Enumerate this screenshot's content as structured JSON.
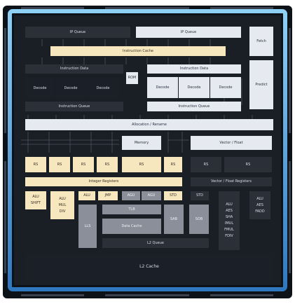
{
  "colors": {
    "outer_glow": "#6fb6ec",
    "die_bg": "#1a1e25",
    "cream_block": "#f6e7bf",
    "light_block": "#e6e9f0",
    "dark_block": "#2a2f38"
  },
  "front_end": {
    "ip_queue_left": "IP Queue",
    "ip_queue_right": "IP Queue",
    "fetch": "Fetch",
    "instruction_cache": "Instruction Cache",
    "predict": "Predict",
    "instruction_data_left": "Instruction Data",
    "instruction_data_right": "Instruction Data",
    "rom": "ROM",
    "decoders_left": [
      "Decode",
      "Decode",
      "Decode"
    ],
    "decoders_right": [
      "Decode",
      "Decode",
      "Decode"
    ],
    "instruction_queue_left": "Instruction Queue",
    "instruction_queue_right": "Instruction Queue"
  },
  "allocation": "Allocation / Rename",
  "memory": "Memory",
  "vector_float": "Vector / Float",
  "rs_row": [
    "RS",
    "RS",
    "RS",
    "RS",
    "RS",
    "RS"
  ],
  "rs_vector": [
    "RS",
    "RS"
  ],
  "integer_registers": "Integer Registers",
  "vector_float_registers": "Vector / Float Registers",
  "exec": {
    "alu_shift": [
      "ALU",
      "SHIFT"
    ],
    "alu_mul_div": [
      "ALU",
      "MUL",
      "DIV"
    ],
    "alu_jmp": [
      "ALU",
      "JMP"
    ],
    "agu": [
      "AGU",
      "AGU"
    ],
    "std": "STD",
    "std2": "STD",
    "vector_units_1": [
      "ALU",
      "AES",
      "SHA",
      "IMUL",
      "FMUL",
      "FDIV"
    ],
    "vector_units_2": [
      "ALU",
      "AES",
      "FADD"
    ]
  },
  "memory_subsystem": {
    "tlb": "TLB",
    "data_cache": "Data Cache",
    "sab": "SAB",
    "sob": "SOB",
    "lls": "LLS",
    "l2_queue": "L2 Queue",
    "l2_cache": "L2 Cache"
  }
}
